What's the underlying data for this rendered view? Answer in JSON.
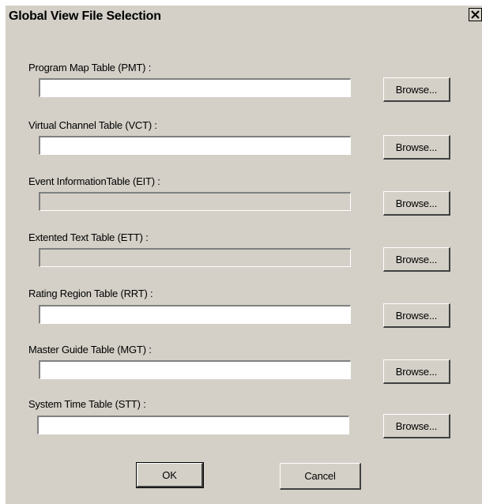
{
  "window": {
    "title": "Global View File Selection",
    "close_glyph": "×"
  },
  "fields": [
    {
      "label": "Program Map Table (PMT) :",
      "value": "",
      "enabled": true
    },
    {
      "label": "Virtual Channel Table (VCT) :",
      "value": "",
      "enabled": true
    },
    {
      "label": "Event InformationTable (EIT) :",
      "value": "",
      "enabled": false
    },
    {
      "label": "Extented Text Table (ETT) :",
      "value": "",
      "enabled": false
    },
    {
      "label": "Rating Region Table (RRT) :",
      "value": "",
      "enabled": true
    },
    {
      "label": "Master Guide Table (MGT) :",
      "value": "",
      "enabled": true
    },
    {
      "label": "System Time Table (STT) :",
      "value": "",
      "enabled": true
    }
  ],
  "browse_label": "Browse...",
  "buttons": {
    "ok_label": "OK",
    "cancel_label": "Cancel"
  }
}
